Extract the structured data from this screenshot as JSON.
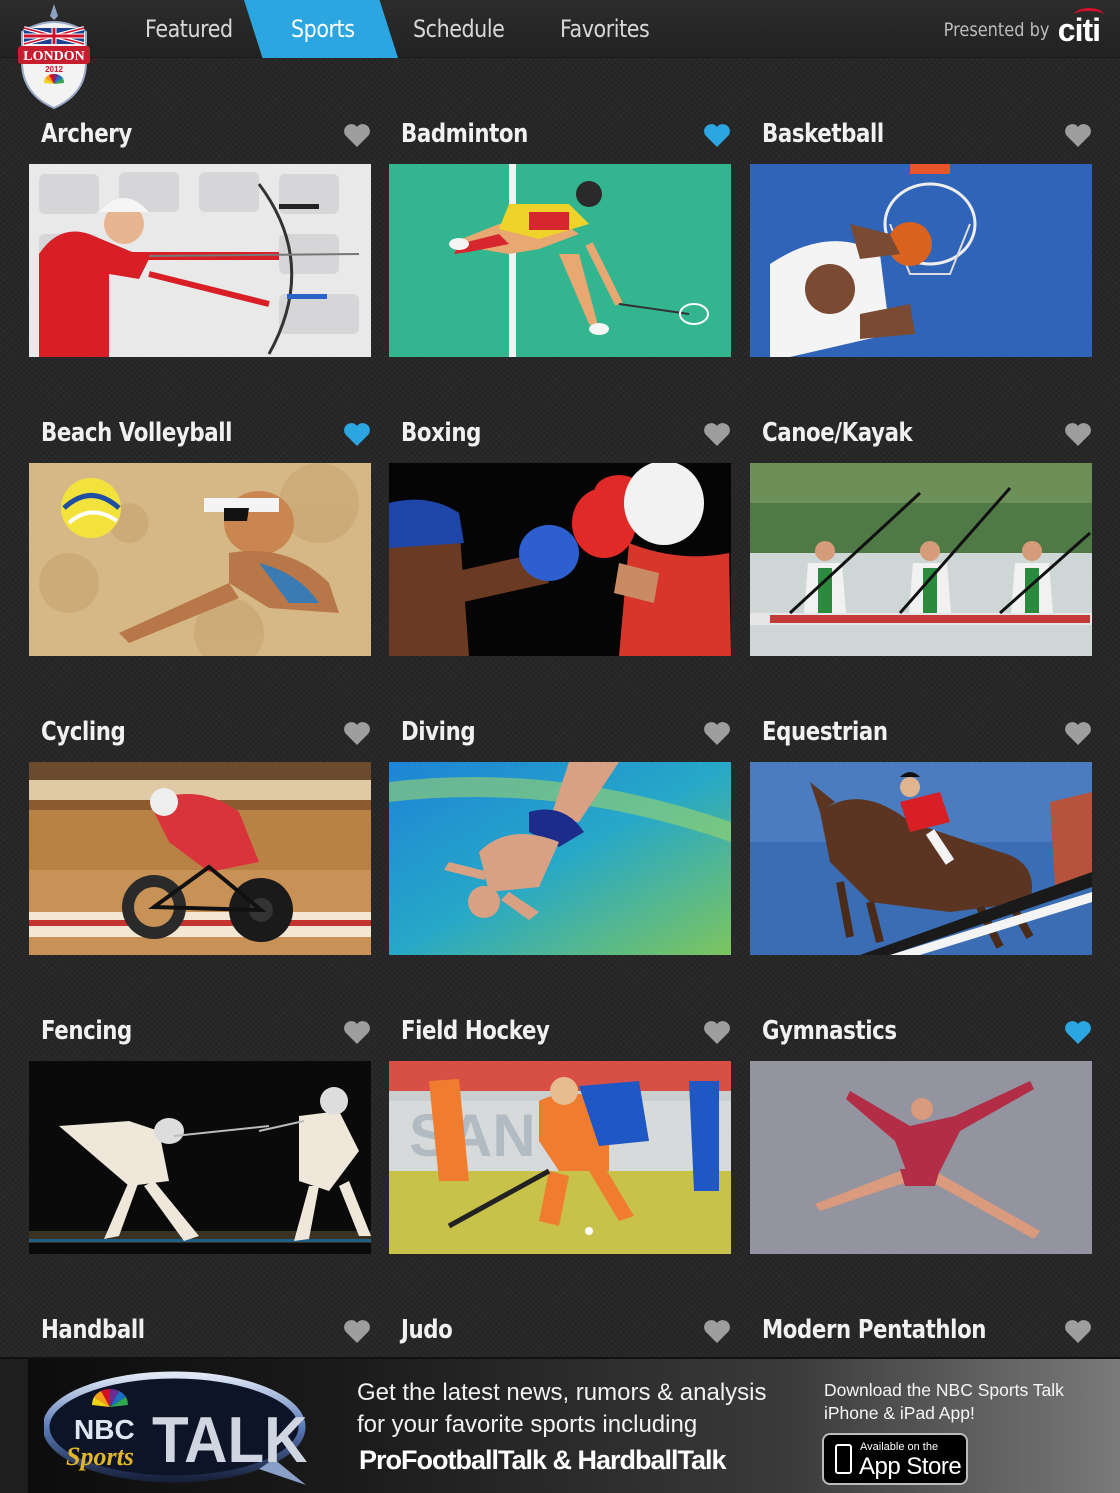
{
  "nav": {
    "tabs": [
      {
        "label": "Featured",
        "active": false
      },
      {
        "label": "Sports",
        "active": true
      },
      {
        "label": "Schedule",
        "active": false
      },
      {
        "label": "Favorites",
        "active": false
      }
    ],
    "presented_by": "Presented by",
    "sponsor": "citi",
    "accent_color": "#2ba6e1"
  },
  "logo": {
    "text_top": "LONDON",
    "text_year": "2012",
    "icon": "nbc-peacock-icon"
  },
  "sports": [
    {
      "name": "Archery",
      "favorite": false
    },
    {
      "name": "Badminton",
      "favorite": true
    },
    {
      "name": "Basketball",
      "favorite": false
    },
    {
      "name": "Beach Volleyball",
      "favorite": true
    },
    {
      "name": "Boxing",
      "favorite": false
    },
    {
      "name": "Canoe/Kayak",
      "favorite": false
    },
    {
      "name": "Cycling",
      "favorite": false
    },
    {
      "name": "Diving",
      "favorite": false
    },
    {
      "name": "Equestrian",
      "favorite": false
    },
    {
      "name": "Fencing",
      "favorite": false
    },
    {
      "name": "Field Hockey",
      "favorite": false
    },
    {
      "name": "Gymnastics",
      "favorite": true
    },
    {
      "name": "Handball",
      "favorite": false
    },
    {
      "name": "Judo",
      "favorite": false
    },
    {
      "name": "Modern Pentathlon",
      "favorite": false
    }
  ],
  "heart_colors": {
    "favorite": "#2ba6e1",
    "default": "#9e9e9e"
  },
  "banner": {
    "logo_nbc": "NBC",
    "logo_sports": "Sports",
    "logo_talk": "TALK",
    "line1": "Get the latest news, rumors & analysis",
    "line2": "for your favorite sports including",
    "strong": "ProFootballTalk & HardballTalk",
    "download_line1": "Download the NBC Sports Talk",
    "download_line2": "iPhone & iPad App!",
    "appstore_small": "Available on the",
    "appstore_big": "App Store"
  }
}
